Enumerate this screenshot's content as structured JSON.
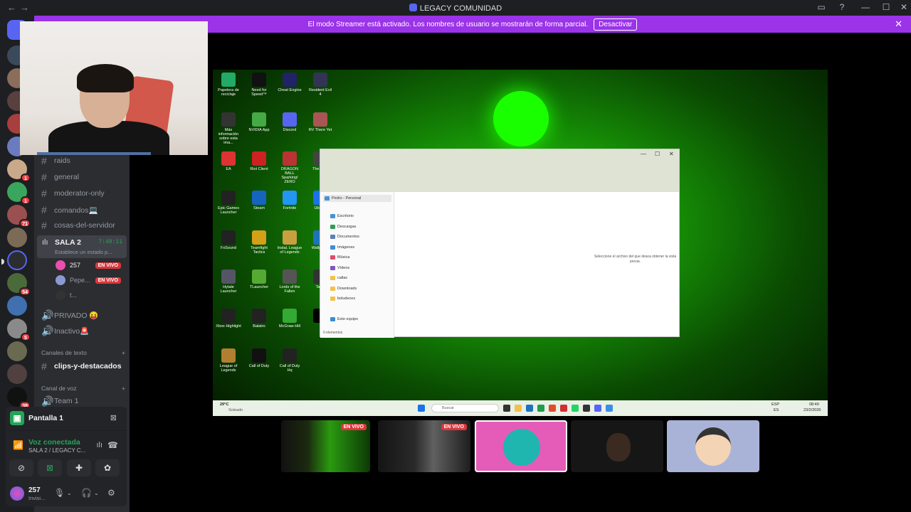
{
  "window": {
    "title": "LEGACY COMUNIDAD",
    "back": "←",
    "forward": "→",
    "controls": [
      "▭",
      "?",
      "—",
      "☐",
      "✕"
    ]
  },
  "banner": {
    "text": "El modo Streamer está activado. Los nombres de usuario se mostrarán de forma parcial.",
    "button": "Desactivar",
    "close": "✕"
  },
  "guilds": {
    "badges": [
      "1",
      "1",
      "71",
      "54",
      "5",
      "38"
    ]
  },
  "channels": {
    "partial_top": "raids",
    "text_channels": [
      "general",
      "moderator-only",
      "comandos💻",
      "cosas-del-servidor"
    ],
    "voice_channel": {
      "name": "SALA 2",
      "timer": "7:48:11",
      "status": "Establece un estado p...",
      "users": [
        {
          "name": "257",
          "live": "EN VIVO"
        },
        {
          "name": "Pepe...",
          "live": "EN VIVO"
        },
        {
          "name": "t...",
          "live": ""
        }
      ]
    },
    "other_voice": [
      "PRIVADO 😝",
      "Inactivo🚨"
    ],
    "category_text": "Canales de texto",
    "category_text_channel": "clips-y-destacados",
    "category_voice": "Canal de voz",
    "category_voice_channel": "Team 1",
    "add": "+"
  },
  "voice_panel": {
    "screen_label": "Pantalla 1",
    "connected": "Voz conectada",
    "location": "SALA 2 / LEGACY C..."
  },
  "user": {
    "name": "257",
    "status": "Invisi..."
  },
  "stage": {
    "desktop_icons": [
      "Papelera de reciclaje",
      "Need for Speed™",
      "Cheat Engine",
      "Resident Evil 4",
      "Más información sobre esta ima...",
      "NVIDIA App",
      "Discord",
      "RV There Yet",
      "EA",
      "Riot Client",
      "DRAGON BALL Sparking! ZERO",
      "The Ab...",
      "Epic Games Launcher",
      "Steam",
      "Fortnite",
      "Ubisoft",
      "FxSound",
      "Teamfight Tactics",
      "Instal. League of Legends",
      "Wallpaper",
      "Hytale Launcher",
      "TLauncher",
      "Lords of the Fallen",
      "Tales",
      "Xbox Highlight",
      "Balatro",
      "McGraw-Hill",
      "",
      "League of Legends",
      "Call of Duty",
      "Call of Duty Hq"
    ],
    "explorer": {
      "breadcrumb": "Pedro - Personal",
      "sidebar": [
        "Escritorio",
        "Descargas",
        "Documentos",
        "Imágenes",
        "Música",
        "Vídeos",
        "callas",
        "Downloads",
        "boludeces"
      ],
      "this_pc": "Este equipo",
      "preview_msg": "Seleccione el archivo del que desea obtener la vista previa.",
      "count": "0 elementos"
    },
    "taskbar": {
      "weather_temp": "29°C",
      "weather_desc": "Soleado",
      "search": "Buscar",
      "lang1": "ESP",
      "lang2": "ES",
      "time": "08:49",
      "date": "23/2/2026"
    }
  },
  "thumbnails": [
    {
      "live": "EN VIVO"
    },
    {
      "live": "EN VIVO"
    },
    {
      "live": ""
    },
    {
      "live": ""
    },
    {
      "live": ""
    }
  ],
  "colors": {
    "accent": "#5865f2",
    "banner": "#9b33e8",
    "live": "#da373c",
    "connected": "#23a559"
  }
}
